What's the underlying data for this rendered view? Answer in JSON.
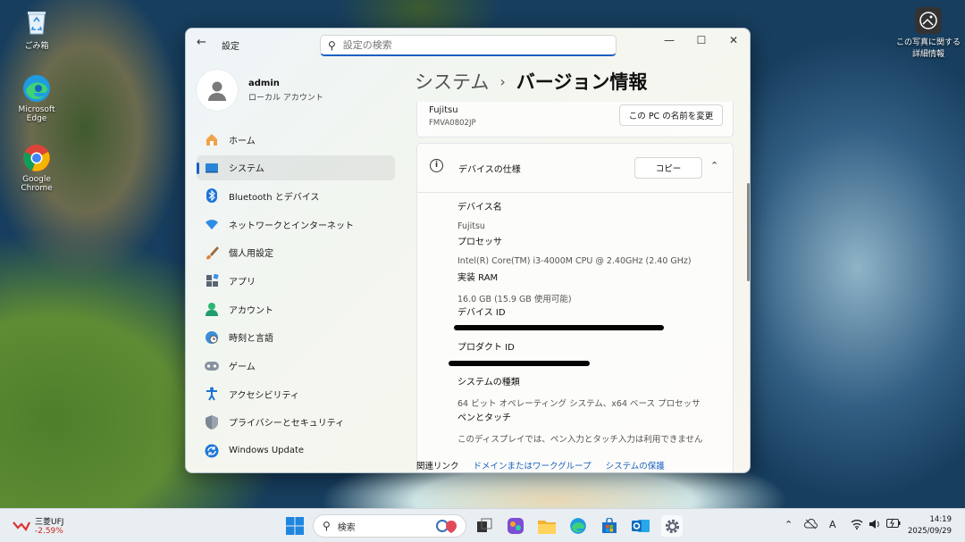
{
  "desktop": {
    "recycle_bin": "ごみ箱",
    "edge": "Microsoft Edge",
    "chrome": "Google Chrome",
    "photo_info": "この写真に関する詳細情報"
  },
  "window": {
    "app_title": "設定",
    "search_placeholder": "設定の検索",
    "minimize": "—",
    "maximize": "☐",
    "close": "✕"
  },
  "profile": {
    "name": "admin",
    "type": "ローカル アカウント"
  },
  "nav": [
    {
      "label": "ホーム",
      "icon": "home-icon"
    },
    {
      "label": "システム",
      "icon": "system-icon"
    },
    {
      "label": "Bluetooth とデバイス",
      "icon": "bluetooth-icon"
    },
    {
      "label": "ネットワークとインターネット",
      "icon": "network-icon"
    },
    {
      "label": "個人用設定",
      "icon": "brush-icon"
    },
    {
      "label": "アプリ",
      "icon": "apps-icon"
    },
    {
      "label": "アカウント",
      "icon": "account-icon"
    },
    {
      "label": "時刻と言語",
      "icon": "time-language-icon"
    },
    {
      "label": "ゲーム",
      "icon": "gamepad-icon"
    },
    {
      "label": "アクセシビリティ",
      "icon": "accessibility-icon"
    },
    {
      "label": "プライバシーとセキュリティ",
      "icon": "shield-icon"
    },
    {
      "label": "Windows Update",
      "icon": "update-icon"
    }
  ],
  "breadcrumb": {
    "parent": "システム",
    "separator": "›",
    "current": "バージョン情報"
  },
  "pc_card": {
    "maker": "Fujitsu",
    "model": "FMVA0802JP",
    "rename_button": "この PC の名前を変更"
  },
  "device_spec": {
    "title": "デバイスの仕様",
    "copy_button": "コピー",
    "items": [
      {
        "label": "デバイス名",
        "value": "Fujitsu"
      },
      {
        "label": "プロセッサ",
        "value": "Intel(R) Core(TM) i3-4000M CPU @ 2.40GHz (2.40 GHz)"
      },
      {
        "label": "実装 RAM",
        "value": "16.0 GB (15.9 GB 使用可能)"
      },
      {
        "label": "デバイス ID",
        "value": ""
      },
      {
        "label": "プロダクト ID",
        "value": ""
      },
      {
        "label": "システムの種類",
        "value": "64 ビット オペレーティング システム、x64 ベース プロセッサ"
      },
      {
        "label": "ペンとタッチ",
        "value": "このディスプレイでは、ペン入力とタッチ入力は利用できません"
      }
    ]
  },
  "related": {
    "title": "関連リンク",
    "links": [
      "ドメインまたはワークグループ",
      "システムの保護"
    ]
  },
  "taskbar": {
    "stock_name": "三菱UFJ",
    "stock_change": "-2.59%",
    "search_label": "検索",
    "ime": "A",
    "time": "14:19",
    "date": "2025/09/29"
  }
}
